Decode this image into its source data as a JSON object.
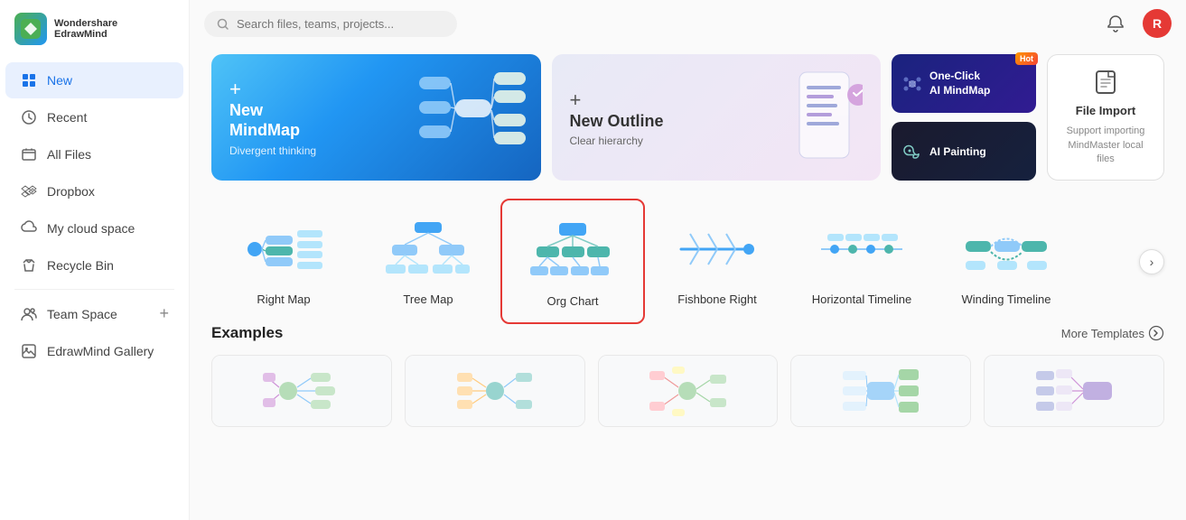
{
  "app": {
    "brand1": "Wondershare",
    "brand2": "EdrawMind"
  },
  "sidebar": {
    "items": [
      {
        "id": "new",
        "label": "New",
        "icon": "🏠",
        "active": true
      },
      {
        "id": "recent",
        "label": "Recent",
        "icon": "🕐"
      },
      {
        "id": "all-files",
        "label": "All Files",
        "icon": "📄"
      },
      {
        "id": "dropbox",
        "label": "Dropbox",
        "icon": "📦"
      },
      {
        "id": "my-cloud",
        "label": "My cloud space",
        "icon": "☁️"
      },
      {
        "id": "recycle",
        "label": "Recycle Bin",
        "icon": "🗑️"
      },
      {
        "id": "team-space",
        "label": "Team Space",
        "icon": "👥",
        "has_add": true
      },
      {
        "id": "gallery",
        "label": "EdrawMind Gallery",
        "icon": "🖼️"
      }
    ]
  },
  "header": {
    "search_placeholder": "Search files, teams, projects...",
    "avatar_letter": "R"
  },
  "new_cards": {
    "mindmap": {
      "plus": "+",
      "title": "New\nMindMap",
      "subtitle": "Divergent thinking"
    },
    "outline": {
      "plus": "+",
      "title": "New Outline",
      "subtitle": "Clear hierarchy"
    },
    "ai_mindmap": {
      "label": "One-Click\nAI MindMap",
      "badge": "Hot"
    },
    "ai_painting": {
      "label": "AI Painting"
    },
    "file_import": {
      "title": "File Import",
      "subtitle": "Support importing MindMaster local files"
    }
  },
  "templates": [
    {
      "id": "right-map",
      "label": "Right Map",
      "selected": false
    },
    {
      "id": "tree-map",
      "label": "Tree Map",
      "selected": false
    },
    {
      "id": "org-chart",
      "label": "Org Chart",
      "selected": true
    },
    {
      "id": "fishbone-right",
      "label": "Fishbone Right",
      "selected": false
    },
    {
      "id": "horizontal-timeline",
      "label": "Horizontal Timeline",
      "selected": false
    },
    {
      "id": "winding-timeline",
      "label": "Winding Timeline",
      "selected": false
    }
  ],
  "examples": {
    "title": "Examples",
    "more_label": "More Templates"
  }
}
